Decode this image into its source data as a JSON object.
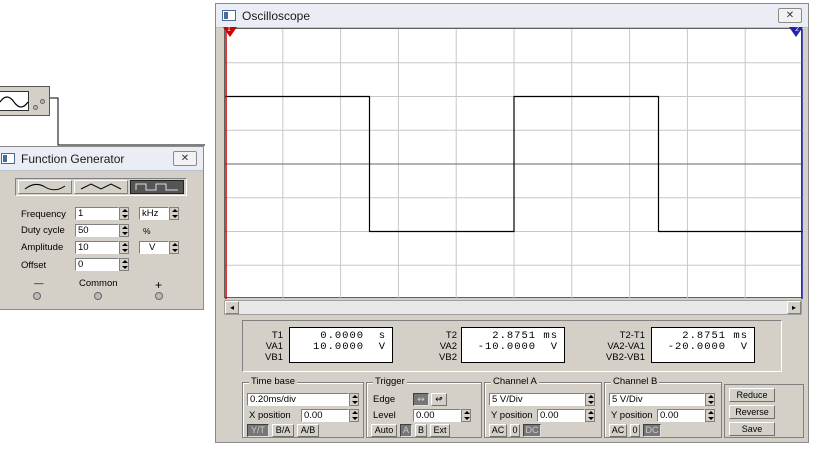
{
  "colors": {
    "window_bg": "#d4d0c8",
    "screen_bg": "#ffffff",
    "grid": "#c8c8c8",
    "trace": "#000000",
    "cursor_t1": "#cc0000",
    "cursor_t2": "#2222aa"
  },
  "function_generator": {
    "title": "Function Generator",
    "waveforms": [
      "sine",
      "triangle",
      "square"
    ],
    "selected_waveform": "square",
    "rows": [
      {
        "label": "Frequency",
        "value": "1",
        "unit": "kHz"
      },
      {
        "label": "Duty cycle",
        "value": "50",
        "unit": "%"
      },
      {
        "label": "Amplitude",
        "value": "10",
        "unit": "V"
      },
      {
        "label": "Offset",
        "value": "0",
        "unit": ""
      }
    ],
    "terminals": {
      "minus": "—",
      "common": "Common",
      "plus": "+"
    }
  },
  "oscilloscope": {
    "title": "Oscilloscope",
    "cursor_markers": {
      "t1": "1",
      "t2": "2"
    },
    "trace": {
      "low": -10,
      "high": 10,
      "period_divs": 5,
      "duty": 0.5,
      "first_high_start_div": 0,
      "total_divs": 10,
      "v_per_div": 5,
      "v_divs": 8
    },
    "readouts": {
      "t1": {
        "labels": [
          "T1",
          "VA1",
          "VB1"
        ],
        "time": "0.0000  s",
        "va": "10.0000  V"
      },
      "t2": {
        "labels": [
          "T2",
          "VA2",
          "VB2"
        ],
        "time": "2.8751 ms",
        "va": "-10.0000  V"
      },
      "diff": {
        "labels": [
          "T2-T1",
          "VA2-VA1",
          "VB2-VB1"
        ],
        "time": "2.8751 ms",
        "va": "-20.0000  V"
      }
    },
    "timebase": {
      "title": "Time base",
      "scale": "0.20ms/div",
      "xpos_label": "X position",
      "xpos": "0.00",
      "modes": [
        "Y/T",
        "B/A",
        "A/B"
      ]
    },
    "trigger": {
      "title": "Trigger",
      "edge_label": "Edge",
      "edge_rising": "↭",
      "edge_falling": "↫",
      "level_label": "Level",
      "level": "0.00",
      "modes": [
        "Auto",
        "A",
        "B",
        "Ext"
      ]
    },
    "channel_a": {
      "title": "Channel A",
      "scale": "5 V/Div",
      "ypos_label": "Y position",
      "ypos": "0.00",
      "coupling": [
        "AC",
        "0",
        "DC"
      ]
    },
    "channel_b": {
      "title": "Channel B",
      "scale": "5 V/Div",
      "ypos_label": "Y position",
      "ypos": "0.00",
      "coupling": [
        "AC",
        "0",
        "DC"
      ]
    },
    "buttons": [
      "Reduce",
      "Reverse",
      "Save"
    ]
  }
}
